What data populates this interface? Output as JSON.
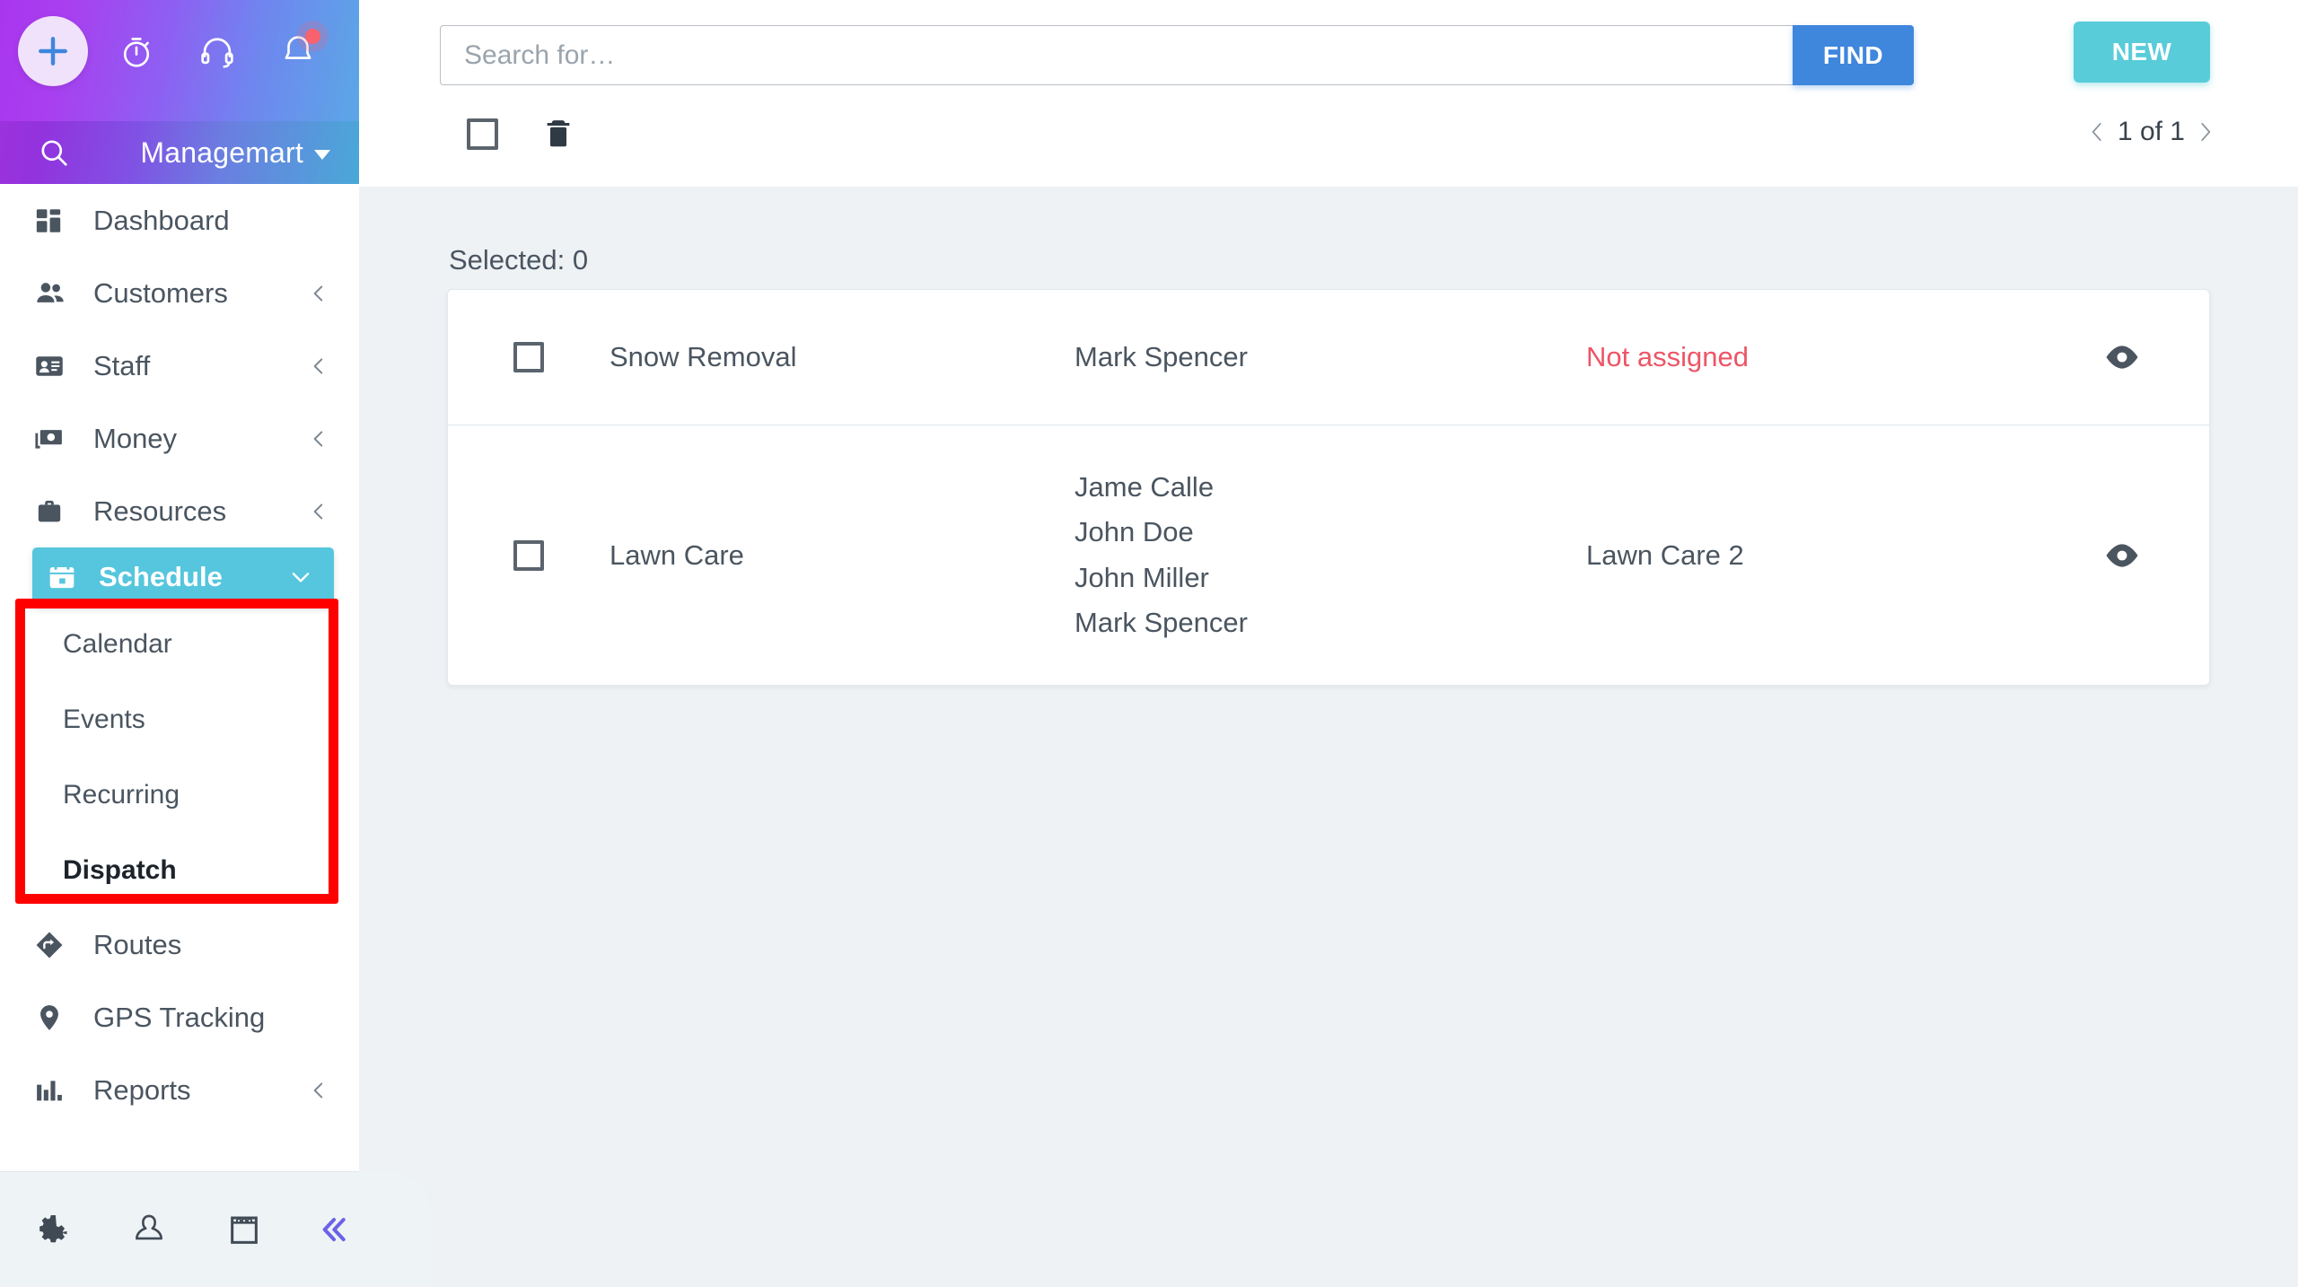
{
  "app": {
    "brand_name": "Managemart",
    "accent_purple": "#9b32dd",
    "accent_blue": "#4aa8d8",
    "accent_teal": "#58ccd8",
    "accent_find_blue": "#3f86dd",
    "highlight_red": "#fe0000",
    "danger_text": "#ed5566"
  },
  "header_icons": [
    {
      "name": "plus-icon",
      "label": "Add"
    },
    {
      "name": "timer-icon",
      "label": "Timer"
    },
    {
      "name": "headset-icon",
      "label": "Support"
    },
    {
      "name": "bell-icon",
      "label": "Notifications",
      "has_badge": true
    }
  ],
  "sidebar": {
    "search_icon": "search-icon",
    "brand": "Managemart",
    "items": [
      {
        "label": "Dashboard",
        "icon": "dashboard-icon",
        "expandable": false
      },
      {
        "label": "Customers",
        "icon": "customers-icon",
        "expandable": true
      },
      {
        "label": "Staff",
        "icon": "staff-card-icon",
        "expandable": true
      },
      {
        "label": "Money",
        "icon": "money-icon",
        "expandable": true
      },
      {
        "label": "Resources",
        "icon": "briefcase-icon",
        "expandable": true
      }
    ],
    "schedule_group": {
      "label": "Schedule",
      "icon": "calendar-icon",
      "expanded": true,
      "highlighted": true,
      "sub_items": [
        {
          "label": "Calendar",
          "active": false
        },
        {
          "label": "Events",
          "active": false
        },
        {
          "label": "Recurring",
          "active": false
        },
        {
          "label": "Dispatch",
          "active": true
        }
      ]
    },
    "items_after": [
      {
        "label": "Routes",
        "icon": "routes-icon",
        "expandable": false
      },
      {
        "label": "GPS Tracking",
        "icon": "pin-icon",
        "expandable": false
      },
      {
        "label": "Reports",
        "icon": "bar-chart-icon",
        "expandable": true
      }
    ],
    "bottom_icons": [
      {
        "name": "gear-icon",
        "label": "Settings"
      },
      {
        "name": "user-icon",
        "label": "Profile"
      },
      {
        "name": "notepad-icon",
        "label": "Notes"
      },
      {
        "name": "collapse-icon",
        "label": "Collapse sidebar"
      }
    ]
  },
  "toolbar": {
    "search_placeholder": "Search for…",
    "search_value": "",
    "find_label": "FIND",
    "new_label": "NEW",
    "pager_text": "1 of 1",
    "prev_icon": "chevron-left-icon",
    "next_icon": "chevron-right-icon",
    "select_all_icon": "checkbox-icon",
    "delete_icon": "trash-icon"
  },
  "list": {
    "selected_label": "Selected: 0",
    "rows": [
      {
        "checked": false,
        "name": "Snow Removal",
        "staff": [
          "Mark Spencer"
        ],
        "status": "Not assigned",
        "status_unassigned": true,
        "view_icon": "eye-icon"
      },
      {
        "checked": false,
        "name": "Lawn Care",
        "staff": [
          "Jame Calle",
          "John Doe",
          "John Miller",
          "Mark Spencer"
        ],
        "status": "Lawn Care 2",
        "status_unassigned": false,
        "view_icon": "eye-icon"
      }
    ]
  }
}
